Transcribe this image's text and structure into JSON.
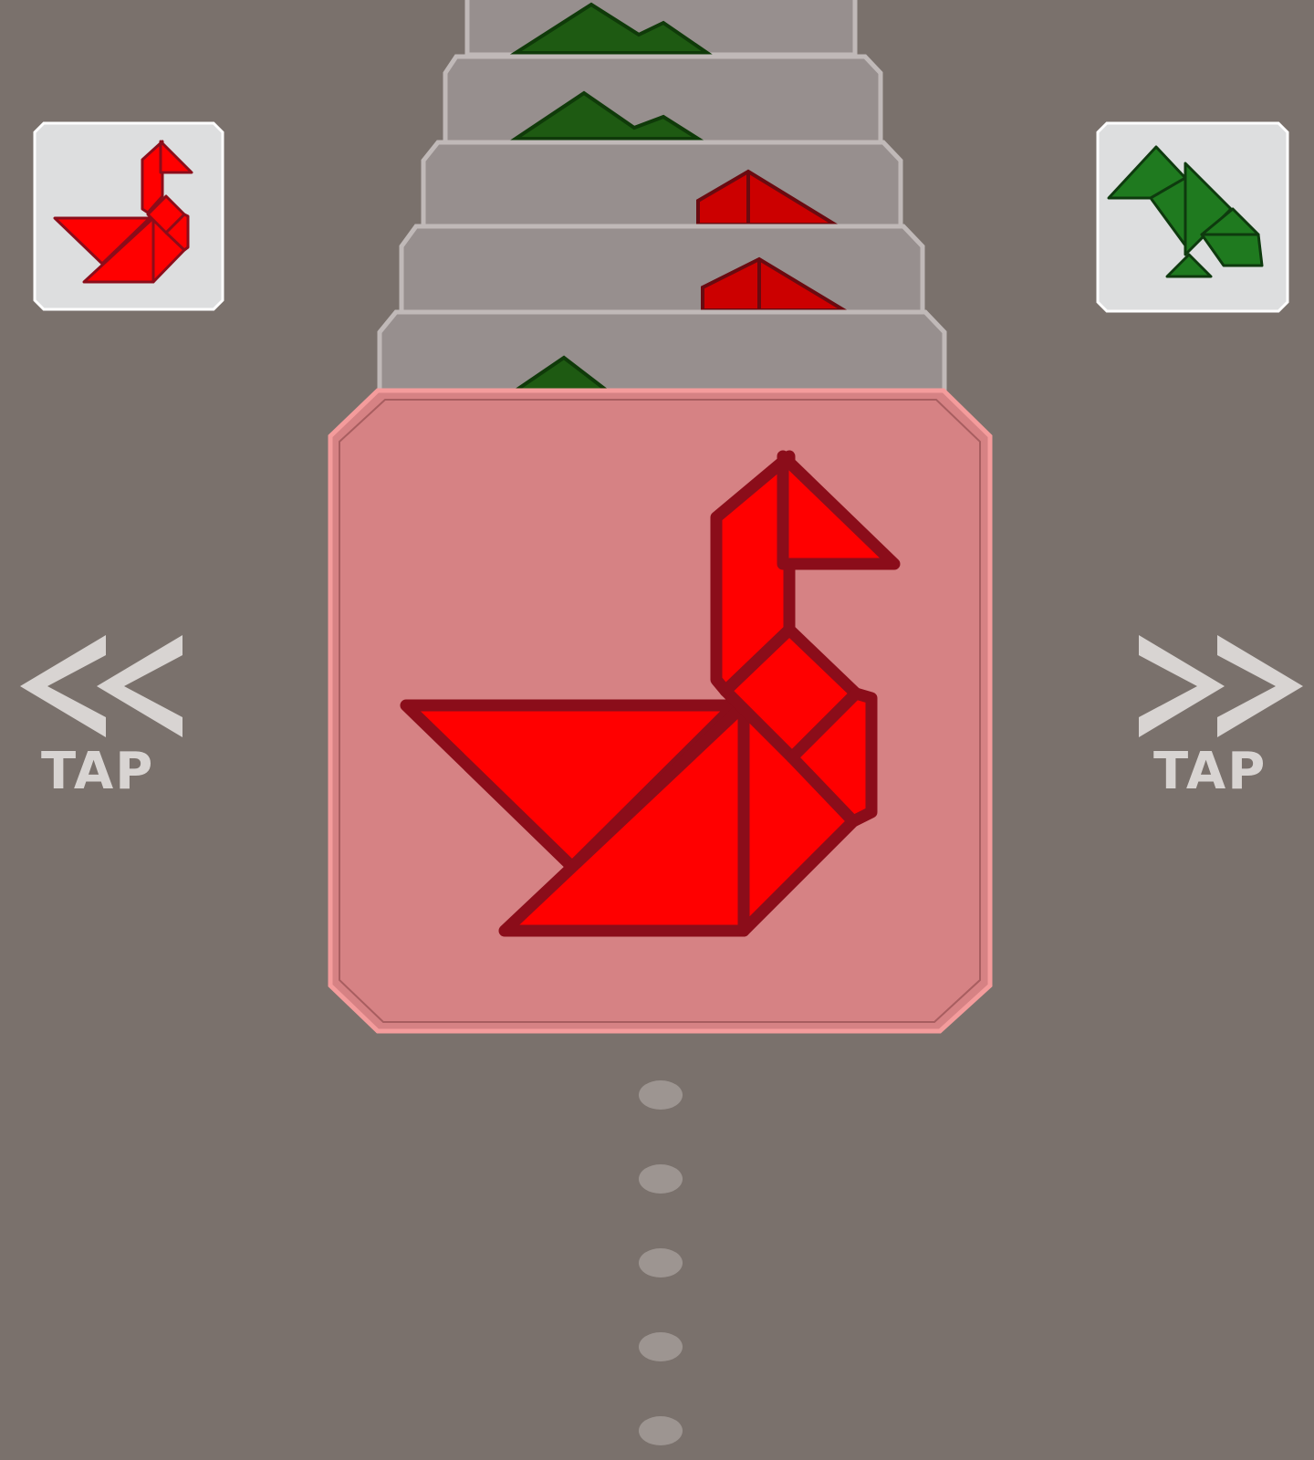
{
  "colors": {
    "background": "#7a716c",
    "stack_card": "#978f8e",
    "stack_card_border": "#c0b9b8",
    "active_card_fill": "#d68284",
    "active_card_border": "#f49c9c",
    "red_piece": "#ff0000",
    "red_outline": "#8b0d1a",
    "green_piece": "#1f7a1f",
    "green_outline": "#0e3a0e",
    "thumb_bg": "#dddedf",
    "tap_text": "#d8d4d2",
    "dot": "#9d9591"
  },
  "navigation": {
    "left": {
      "icon": "double-chevron-left-icon",
      "label": "TAP"
    },
    "right": {
      "icon": "double-chevron-right-icon",
      "label": "TAP"
    }
  },
  "thumbnails": {
    "left": {
      "shape": "swan",
      "color": "red"
    },
    "right": {
      "shape": "bird",
      "color": "green"
    }
  },
  "card_stack": [
    {
      "shape": "mountain",
      "color": "green"
    },
    {
      "shape": "mountain",
      "color": "green"
    },
    {
      "shape": "triangle",
      "color": "red"
    },
    {
      "shape": "triangle",
      "color": "red"
    },
    {
      "shape": "mountain",
      "color": "green"
    }
  ],
  "active_card": {
    "shape": "swan",
    "color": "red"
  },
  "pager_dots": 5
}
